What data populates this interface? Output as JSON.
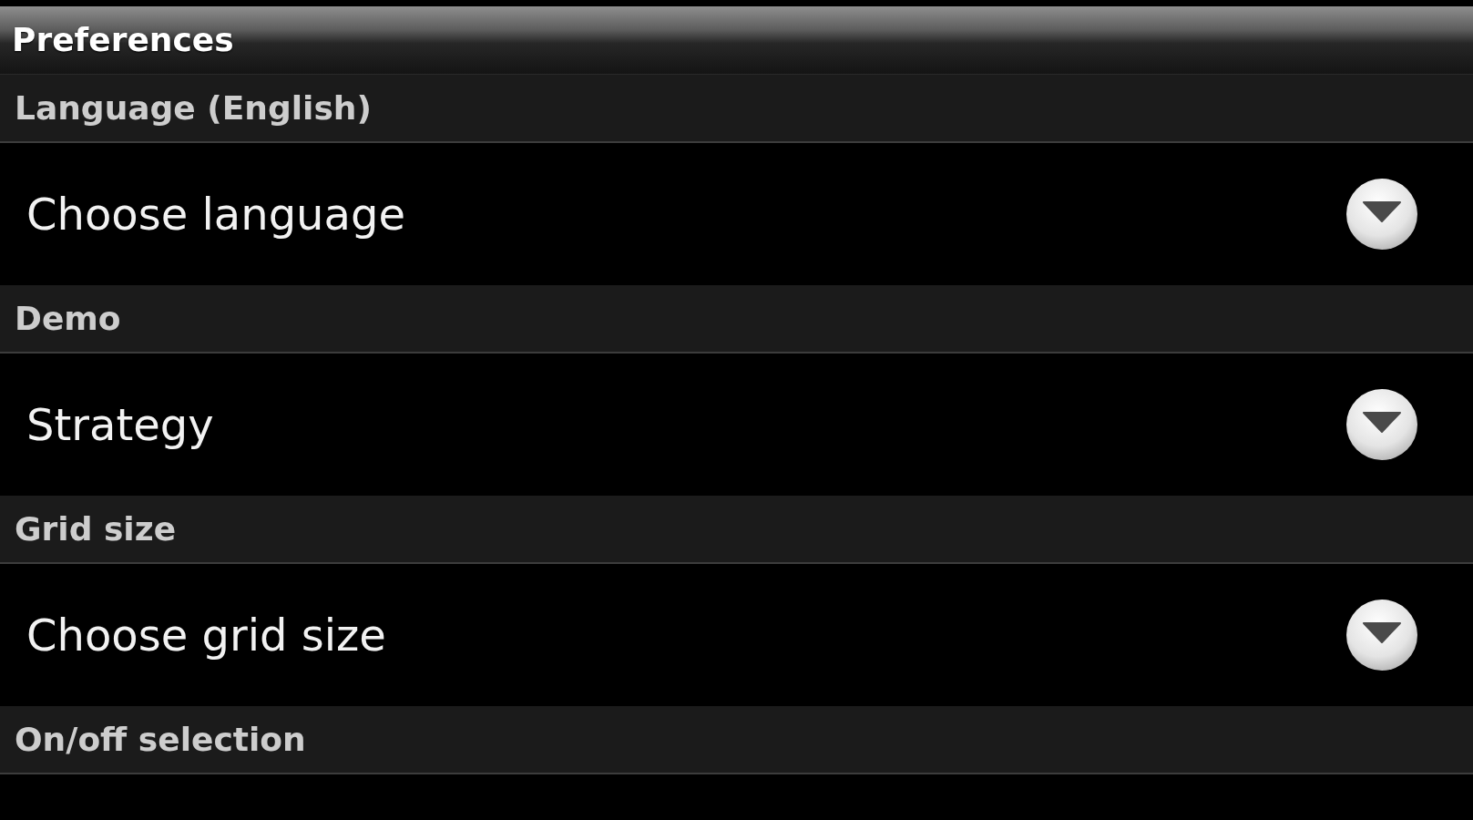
{
  "title_bar": {
    "title": "Preferences"
  },
  "sections": [
    {
      "header": "Language (English)",
      "item": {
        "kind": "dropdown",
        "label": "Choose language"
      }
    },
    {
      "header": "Demo",
      "item": {
        "kind": "dropdown",
        "label": "Strategy"
      }
    },
    {
      "header": "Grid size",
      "item": {
        "kind": "dropdown",
        "label": "Choose grid size"
      }
    },
    {
      "header": "On/off selection"
    }
  ]
}
